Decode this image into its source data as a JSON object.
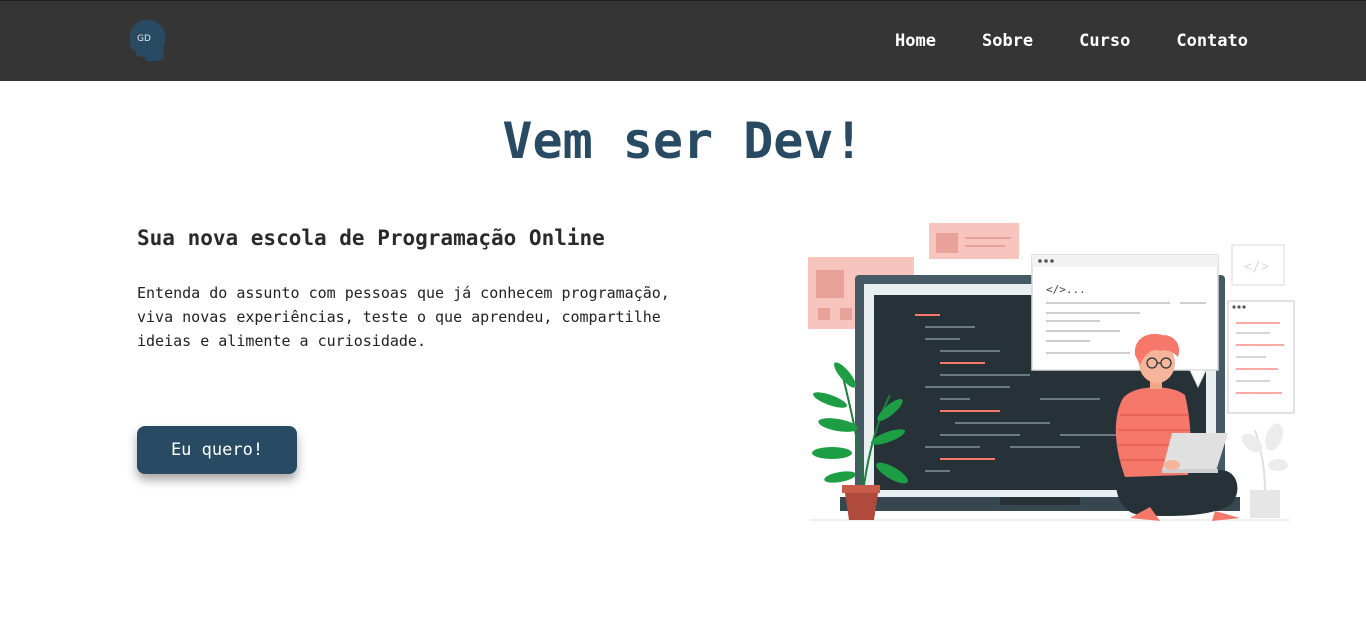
{
  "logo": {
    "text": "GD",
    "icon": "head-silhouette-icon"
  },
  "nav": {
    "items": [
      {
        "label": "Home"
      },
      {
        "label": "Sobre"
      },
      {
        "label": "Curso"
      },
      {
        "label": "Contato"
      }
    ]
  },
  "hero": {
    "title": "Vem ser Dev!",
    "subtitle": "Sua nova escola de Programação Online",
    "description": "Entenda do assunto com pessoas que já conhecem programação, viva novas experiências, teste o que aprendeu, compartilhe ideias e alimente a curiosidade.",
    "cta_label": "Eu quero!",
    "code_tag": "</>..."
  },
  "colors": {
    "navbar": "#353535",
    "primary": "#284b63",
    "accent": "#f5786a"
  }
}
